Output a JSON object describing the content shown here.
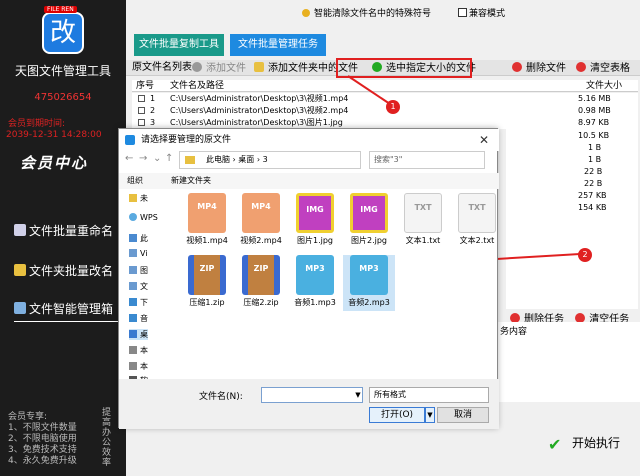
{
  "sidebar": {
    "logo_char": "改",
    "logo_badge": "FILE REN",
    "title": "天图文件管理工具",
    "qq": "475026654",
    "expire_label": "会员到期时间:",
    "expire_value": "2039-12-31 14:28:00",
    "member_center": "会员中心",
    "nav": [
      "文件批量重命名",
      "文件夹批量改名",
      "文件智能管理箱"
    ],
    "vip_lines": [
      "会员专享:",
      "1、不限文件数量",
      "2、不限电脑使用",
      "3、免费技术支持",
      "4、永久免费升级"
    ],
    "vip_side": "提高办公效率"
  },
  "main": {
    "top_text": "智能清除文件名中的特殊符号",
    "compat": "兼容模式",
    "tabs": [
      "文件批量复制工具",
      "文件批量管理任务"
    ],
    "toolbar_label": "原文件名列表:",
    "toolbar": {
      "add_file": "添加文件",
      "add_folder": "添加文件夹中的文件",
      "select_size": "选中指定大小的文件",
      "delete": "删除文件",
      "clear": "清空表格"
    },
    "table_headers": {
      "no": "序号",
      "path": "文件名及路径",
      "size": "文件大小"
    },
    "rows": [
      {
        "no": "1",
        "path": "C:\\Users\\Administrator\\Desktop\\3\\视频1.mp4",
        "size": "5.16 MB"
      },
      {
        "no": "2",
        "path": "C:\\Users\\Administrator\\Desktop\\3\\视频2.mp4",
        "size": "0.98 MB"
      },
      {
        "no": "3",
        "path": "C:\\Users\\Administrator\\Desktop\\3\\图片1.jpg",
        "size": "8.97 KB"
      }
    ],
    "extra_sizes": [
      "10.5 KB",
      "1 B",
      "1 B",
      "22 B",
      "22 B",
      "257 KB",
      "154 KB"
    ],
    "lower_toolbar": {
      "delete_task": "删除任务",
      "clear_task": "清空任务"
    },
    "task_header": "务内容",
    "execute": "开始执行"
  },
  "dialog": {
    "title": "请选择要管理的原文件",
    "path_parts": [
      "此电脑",
      "桌面",
      "3"
    ],
    "search_placeholder": "搜索\"3\"",
    "organize": "组织",
    "new_folder": "新建文件夹",
    "tree": [
      "未",
      "WPS",
      "此",
      "Vi",
      "图",
      "文",
      "下",
      "音",
      "桌",
      "本",
      "本",
      "软"
    ],
    "files": [
      {
        "name": "视频1.mp4",
        "kind": "MP4"
      },
      {
        "name": "视频2.mp4",
        "kind": "MP4"
      },
      {
        "name": "图片1.jpg",
        "kind": "IMG"
      },
      {
        "name": "图片2.jpg",
        "kind": "IMG"
      },
      {
        "name": "文本1.txt",
        "kind": "TXT"
      },
      {
        "name": "文本2.txt",
        "kind": "TXT"
      },
      {
        "name": "压缩1.zip",
        "kind": "ZIP"
      },
      {
        "name": "压缩2.zip",
        "kind": "ZIP"
      },
      {
        "name": "音频1.mp3",
        "kind": "MP3"
      },
      {
        "name": "音频2.mp3",
        "kind": "MP3"
      }
    ],
    "filename_label": "文件名(N):",
    "filename_value": "",
    "type_value": "所有格式",
    "open": "打开(O)",
    "cancel": "取消"
  },
  "annotations": [
    "1",
    "2",
    "3"
  ],
  "colors": {
    "tab_blue": "#1e8ae0",
    "tab_teal": "#1a9a8a",
    "red_annotation": "#e02020",
    "sidebar_bg": "#1c1c1c"
  }
}
